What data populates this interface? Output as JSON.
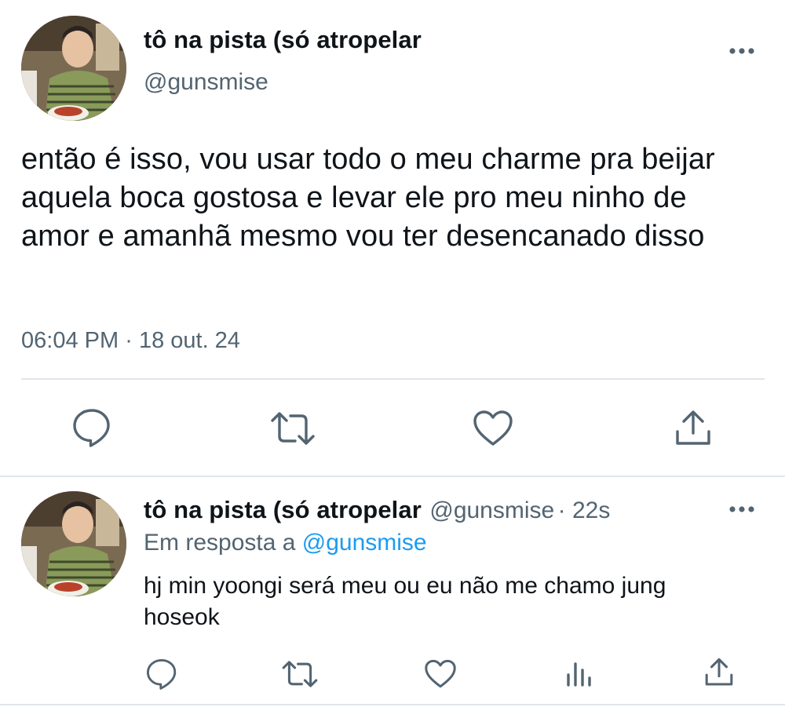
{
  "main_tweet": {
    "display_name": "tô na pista (só atropelar",
    "handle": "@gunsmise",
    "text": "então é isso, vou usar todo o meu charme pra beijar aquela boca gostosa e levar ele pro meu ninho de amor e amanhã mesmo vou ter desencanado disso",
    "time": "06:04 PM",
    "separator": "·",
    "date": "18 out. 24"
  },
  "reply_tweet": {
    "display_name": "tô na pista (só atropelar",
    "handle": "@gunsmise",
    "age": "· 22s",
    "reply_prefix": "Em resposta a",
    "reply_to": "@gunsmise",
    "text": "hj min yoongi será meu ou eu não me chamo jung hoseok"
  },
  "icons": {
    "more": "more-horizontal-icon",
    "reply": "reply-icon",
    "retweet": "retweet-icon",
    "like": "like-icon",
    "share": "share-icon",
    "views": "views-icon"
  },
  "colors": {
    "text": "#0f1419",
    "secondary": "#536471",
    "link": "#1d9bf0",
    "divider": "#e1e6ea"
  }
}
